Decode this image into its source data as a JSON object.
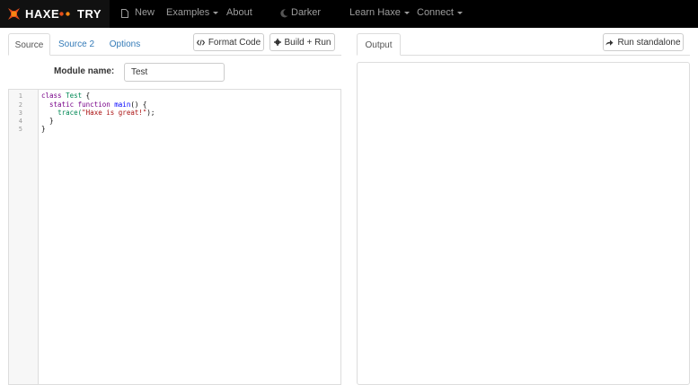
{
  "brand": {
    "name": "HAXE",
    "suffix": "TRY"
  },
  "nav": {
    "new": "New",
    "examples": "Examples",
    "about": "About",
    "darker": "Darker",
    "learn": "Learn Haxe",
    "connect": "Connect"
  },
  "tabs": {
    "source": "Source",
    "source2": "Source 2",
    "options": "Options",
    "output": "Output"
  },
  "buttons": {
    "format": "Format Code",
    "build": "Build + Run",
    "standalone": "Run standalone"
  },
  "module": {
    "label": "Module name:",
    "value": "Test"
  },
  "gutter": [
    "1",
    "2",
    "3",
    "4",
    "5"
  ],
  "code": {
    "l1_kw": "class",
    "l1_type": "Test",
    "l1_rest": " {",
    "l2_indent": "  ",
    "l2_kw1": "static",
    "l2_kw2": "function",
    "l2_def": "main",
    "l2_rest": "() {",
    "l3_indent": "    ",
    "l3_call": "trace(",
    "l3_str": "\"Haxe is great!\"",
    "l3_rest": ");",
    "l4": "  }",
    "l5": "}"
  },
  "colors": {
    "brand_red": "#e24e1b",
    "nav_bg": "#000000",
    "link": "#337ab7"
  }
}
